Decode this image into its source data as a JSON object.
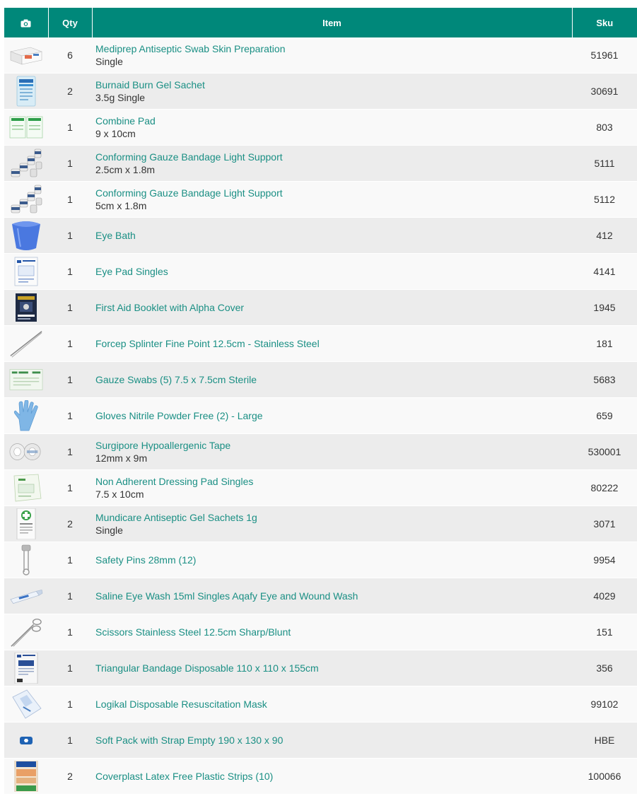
{
  "header": {
    "photo_icon": "camera-icon",
    "qty": "Qty",
    "item": "Item",
    "sku": "Sku"
  },
  "colors": {
    "header_bg": "#00887a",
    "link": "#1a8f84"
  },
  "rows": [
    {
      "qty": "6",
      "name": "Mediprep Antiseptic Swab Skin Preparation",
      "variant": "Single",
      "sku": "51961",
      "icon": "swab-box-image"
    },
    {
      "qty": "2",
      "name": "Burnaid Burn Gel Sachet",
      "variant": "3.5g Single",
      "sku": "30691",
      "icon": "burn-gel-image"
    },
    {
      "qty": "1",
      "name": "Combine Pad",
      "variant": "9 x 10cm",
      "sku": "803",
      "icon": "combine-pad-image"
    },
    {
      "qty": "1",
      "name": "Conforming Gauze Bandage Light Support",
      "variant": "2.5cm x 1.8m",
      "sku": "5111",
      "icon": "bandage-rolls-image"
    },
    {
      "qty": "1",
      "name": "Conforming Gauze Bandage Light Support",
      "variant": "5cm x 1.8m",
      "sku": "5112",
      "icon": "bandage-rolls-image"
    },
    {
      "qty": "1",
      "name": "Eye Bath",
      "variant": "",
      "sku": "412",
      "icon": "eye-bath-image"
    },
    {
      "qty": "1",
      "name": "Eye Pad Singles",
      "variant": "",
      "sku": "4141",
      "icon": "eye-pad-image"
    },
    {
      "qty": "1",
      "name": "First Aid Booklet with Alpha Cover",
      "variant": "",
      "sku": "1945",
      "icon": "booklet-image"
    },
    {
      "qty": "1",
      "name": "Forcep Splinter Fine Point 12.5cm - Stainless Steel",
      "variant": "",
      "sku": "181",
      "icon": "forceps-image"
    },
    {
      "qty": "1",
      "name": "Gauze Swabs (5) 7.5 x 7.5cm Sterile",
      "variant": "",
      "sku": "5683",
      "icon": "gauze-swabs-image"
    },
    {
      "qty": "1",
      "name": "Gloves Nitrile Powder Free (2) - Large",
      "variant": "",
      "sku": "659",
      "icon": "glove-image"
    },
    {
      "qty": "1",
      "name": "Surgipore Hypoallergenic Tape",
      "variant": "12mm x 9m",
      "sku": "530001",
      "icon": "tape-image"
    },
    {
      "qty": "1",
      "name": "Non Adherent Dressing Pad Singles",
      "variant": "7.5 x 10cm",
      "sku": "80222",
      "icon": "dressing-pad-image"
    },
    {
      "qty": "2",
      "name": "Mundicare Antiseptic Gel Sachets 1g",
      "variant": "Single",
      "sku": "3071",
      "icon": "gel-sachet-image"
    },
    {
      "qty": "1",
      "name": "Safety Pins 28mm (12)",
      "variant": "",
      "sku": "9954",
      "icon": "safety-pin-image"
    },
    {
      "qty": "1",
      "name": "Saline Eye Wash 15ml Singles Aqafy Eye and Wound Wash",
      "variant": "",
      "sku": "4029",
      "icon": "saline-vial-image"
    },
    {
      "qty": "1",
      "name": "Scissors Stainless Steel 12.5cm Sharp/Blunt",
      "variant": "",
      "sku": "151",
      "icon": "scissors-image"
    },
    {
      "qty": "1",
      "name": "Triangular Bandage Disposable 110 x 110 x 155cm",
      "variant": "",
      "sku": "356",
      "icon": "triangular-bandage-image"
    },
    {
      "qty": "1",
      "name": "Logikal Disposable Resuscitation Mask",
      "variant": "",
      "sku": "99102",
      "icon": "resus-mask-image"
    },
    {
      "qty": "1",
      "name": "Soft Pack with Strap Empty 190 x 130 x 90",
      "variant": "",
      "sku": "HBE",
      "icon": "soft-pack-image"
    },
    {
      "qty": "2",
      "name": "Coverplast Latex Free Plastic Strips (10)",
      "variant": "",
      "sku": "100066",
      "icon": "plastic-strips-image"
    }
  ]
}
